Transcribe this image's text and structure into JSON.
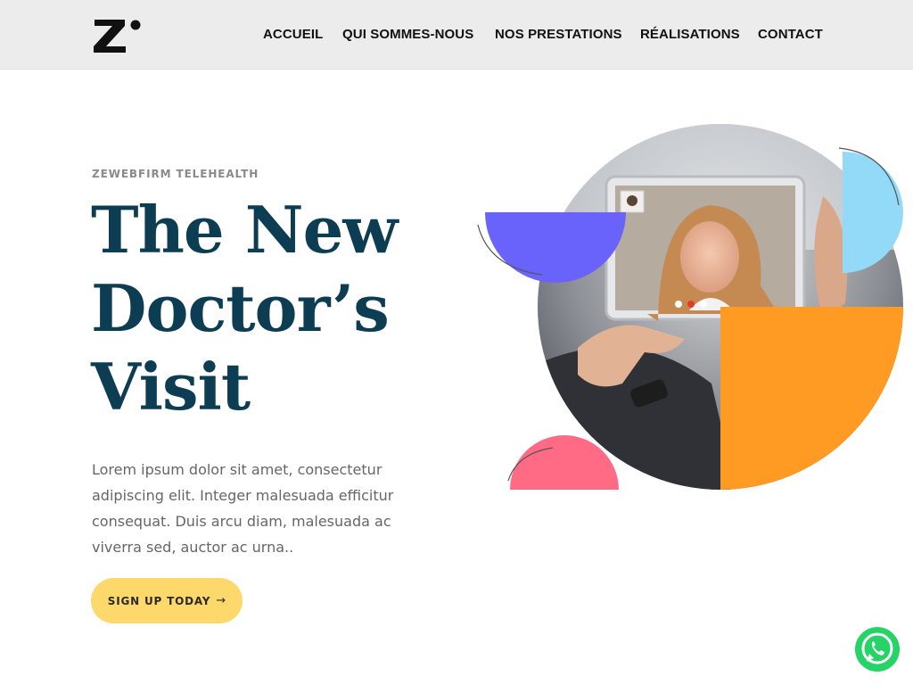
{
  "header": {
    "logo_icon": "z-logo-icon",
    "nav": [
      {
        "label": "ACCUEIL"
      },
      {
        "label": "QUI SOMMES-NOUS"
      },
      {
        "label": "NOS PRESTATIONS"
      },
      {
        "label": "RÉALISATIONS"
      },
      {
        "label": "CONTACT"
      }
    ]
  },
  "hero": {
    "eyebrow": "ZEWEBFIRM TELEHEALTH",
    "title_lines": [
      "The New",
      "Doctor’s",
      "Visit"
    ],
    "body": "Lorem ipsum dolor sit amet, consectetur adipiscing elit. Integer malesuada efficitur consequat. Duis arcu diam, malesuada ac viverra sed, auctor ac urna..",
    "cta_label": "SIGN UP TODAY",
    "cta_icon": "arrow-right-icon"
  },
  "colors": {
    "brand_dark": "#0c3d52",
    "cta_yellow": "#fdd86b",
    "accent_purple": "#6a63fb",
    "accent_orange": "#ff9a22",
    "accent_pink": "#ff6a85",
    "accent_lightblue": "#93daf9",
    "whatsapp_green": "#25d366"
  },
  "floating": {
    "whatsapp_icon": "whatsapp-icon"
  }
}
